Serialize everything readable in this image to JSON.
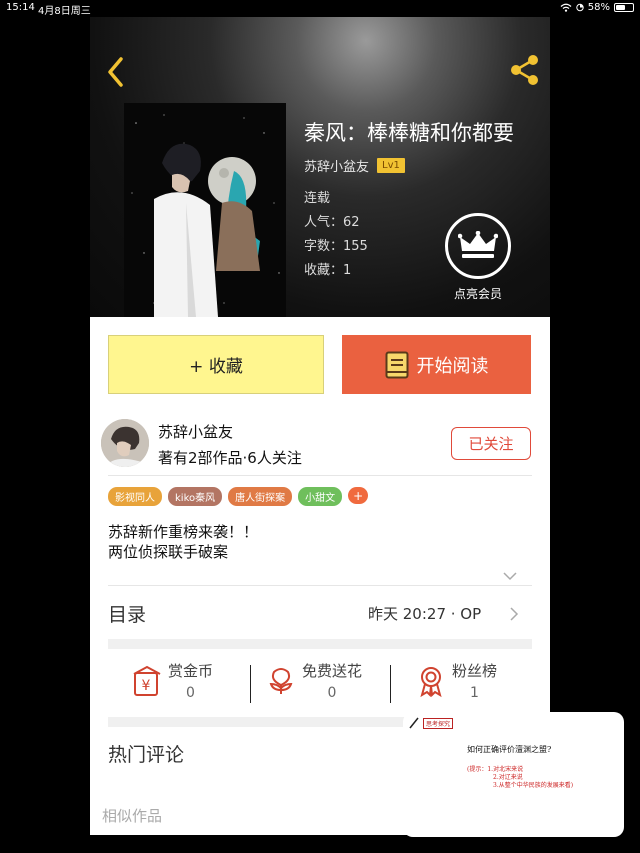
{
  "status_bar": {
    "time": "15:14",
    "date": "4月8日周三",
    "battery": "58%",
    "battery_level": 0.58
  },
  "book": {
    "title": "秦风：棒棒糖和你都要",
    "author": "苏辞小盆友",
    "level": "Lv1",
    "status": "连载",
    "popularity": "人气：62",
    "word_count": "字数：155",
    "collections": "收藏：1"
  },
  "vip": {
    "label": "点亮会员"
  },
  "actions": {
    "collect": "+ 收藏",
    "read": "开始阅读"
  },
  "author": {
    "name": "苏辞小盆友",
    "stats": "著有2部作品·6人关注",
    "follow": "已关注"
  },
  "tags": [
    {
      "label": "影视同人",
      "color": "#e8a33a"
    },
    {
      "label": "kiko秦风",
      "color": "#b37563"
    },
    {
      "label": "唐人街探案",
      "color": "#e07a45"
    },
    {
      "label": "小甜文",
      "color": "#6fbf5c"
    }
  ],
  "tag_add": "+",
  "intro": {
    "line1": "苏辞新作重榜来袭！！",
    "line2": "两位侦探联手破案"
  },
  "toc": {
    "label": "目录",
    "latest": "昨天 20:27 · OP"
  },
  "stats": [
    {
      "label": "赏金币",
      "value": "0",
      "icon": "coin-envelope-icon"
    },
    {
      "label": "免费送花",
      "value": "0",
      "icon": "flower-icon"
    },
    {
      "label": "粉丝榜",
      "value": "1",
      "icon": "medal-icon"
    }
  ],
  "hot_comments": {
    "label": "热门评论"
  },
  "similar": {
    "label": "相似作品"
  },
  "thumbnail": {
    "tag": "思考探究",
    "question": "如何正确评价澶渊之盟?",
    "hints": [
      "(提示：1.对北宋来说",
      "2.对辽来说",
      "3.从整个中华民族的发展来看)"
    ]
  },
  "colors": {
    "accent": "#ea6140",
    "collect_bg": "#fff68f",
    "level_badge": "#f1c232",
    "follow": "#e04a3a"
  }
}
